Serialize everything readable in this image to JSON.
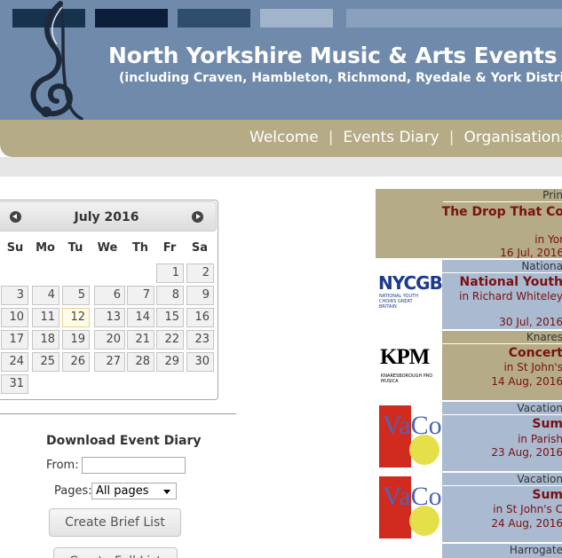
{
  "header": {
    "title": "North Yorkshire Music & Arts Events Diary",
    "subtitle": "(including Craven, Hambleton, Richmond, Ryedale & York Districts)",
    "logo_icon": "treble-clef-icon",
    "colors": {
      "header_bg": "#6f8aab",
      "nav_bg": "#b5ab86",
      "event_title": "#7a1010"
    }
  },
  "nav": {
    "items": [
      "Welcome",
      "Events Diary",
      "Organisations"
    ],
    "separator": "|"
  },
  "calendar": {
    "month_title": "July 2016",
    "prev_icon": "prev-month-icon",
    "next_icon": "next-month-icon",
    "weekdays": [
      "Su",
      "Mo",
      "Tu",
      "We",
      "Th",
      "Fr",
      "Sa"
    ],
    "today": 12,
    "days": [
      "1",
      "2",
      "3",
      "4",
      "5",
      "6",
      "7",
      "8",
      "9",
      "10",
      "11",
      "12",
      "13",
      "14",
      "15",
      "16",
      "17",
      "18",
      "19",
      "20",
      "21",
      "22",
      "23",
      "24",
      "25",
      "26",
      "27",
      "28",
      "29",
      "30",
      "31"
    ]
  },
  "download": {
    "title": "Download Event Diary",
    "from_label": "From:",
    "from_value": "",
    "pages_label": "Pages:",
    "pages_value": "All pages",
    "brief_button": "Create Brief List",
    "full_button": "Create Full List"
  },
  "events": [
    {
      "category": "Prin",
      "title": "The Drop That Co",
      "venue": "in Yor",
      "date": "16 Jul, 2016"
    },
    {
      "category": "Nationa",
      "title": "National Youth",
      "venue": "in Richard Whiteley",
      "date": "30 Jul, 2016",
      "logo_text": "NYCGB",
      "logo_sub": "NATIONAL YOUTH CHOIRS GREAT BRITAIN"
    },
    {
      "category": "Knares",
      "title": "Concert",
      "venue": "in St John's",
      "date": "14 Aug, 2016",
      "logo_text": "KPM",
      "logo_sub": "KNARESBOROUGH PRO MUSICA"
    },
    {
      "category": "Vacation",
      "title": "Sum",
      "venue": "in Parish",
      "date": "23 Aug, 2016",
      "logo_text": "VaCo"
    },
    {
      "category": "Vacation",
      "title": "Sum",
      "venue": "in St John's C",
      "date": "24 Aug, 2016",
      "logo_text": "VaCo"
    },
    {
      "category": "Harrogate"
    }
  ]
}
